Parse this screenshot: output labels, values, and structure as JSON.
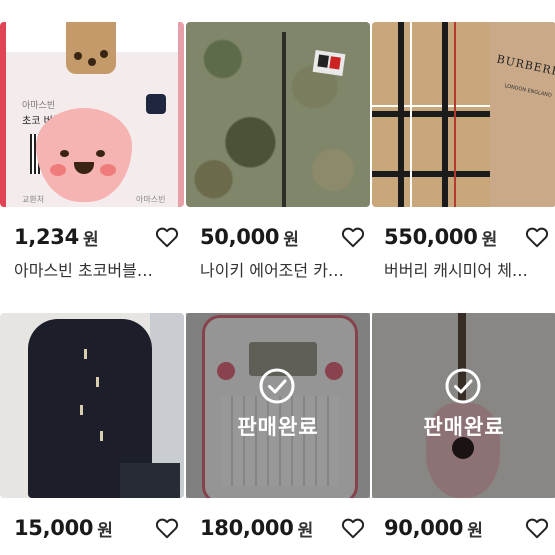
{
  "products": [
    {
      "price": "1,234",
      "currency": "원",
      "title": "아마스빈 초코버블…",
      "sold": false,
      "sold_label": "",
      "thumb_texts": {
        "shop": "아마스빈",
        "name": "초코 버블티",
        "brand_small": "아마스빈",
        "left_small": "교환처"
      }
    },
    {
      "price": "50,000",
      "currency": "원",
      "title": "나이키 에어조던 카…",
      "sold": false,
      "sold_label": ""
    },
    {
      "price": "550,000",
      "currency": "원",
      "title": "버버리 캐시미어 체…",
      "sold": false,
      "sold_label": "",
      "thumb_texts": {
        "brand": "BURBERRY",
        "sub": "LONDON ENGLAND"
      }
    },
    {
      "price": "15,000",
      "currency": "원",
      "title": "",
      "sold": false,
      "sold_label": ""
    },
    {
      "price": "180,000",
      "currency": "원",
      "title": "",
      "sold": true,
      "sold_label": "판매완료"
    },
    {
      "price": "90,000",
      "currency": "원",
      "title": "",
      "sold": true,
      "sold_label": "판매완료"
    }
  ],
  "colors": {
    "accent": "#1a1a1a",
    "sold_overlay": "rgba(0,0,0,0.38)"
  }
}
